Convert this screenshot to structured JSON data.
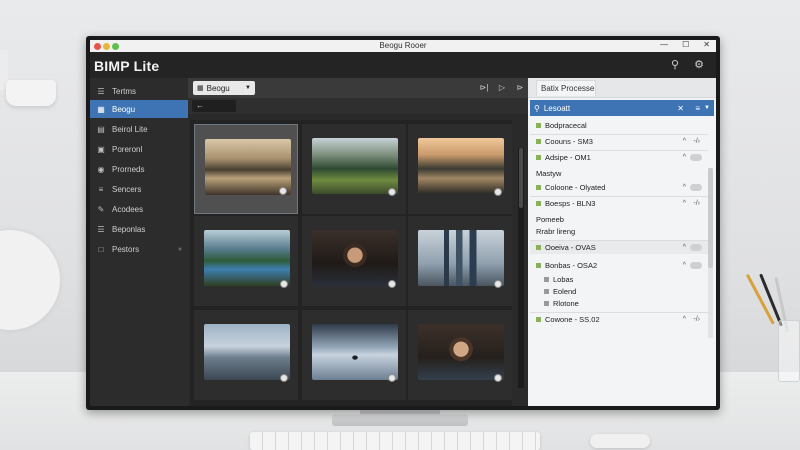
{
  "window": {
    "title": "Beogu Rooer",
    "controls": [
      "—",
      "☐",
      "✕"
    ]
  },
  "app": {
    "title": "BIMP Lite",
    "header_icons": [
      "search-icon",
      "settings-icon"
    ]
  },
  "sidebar": {
    "items": [
      {
        "label": "Tertms",
        "icon": "stack-icon",
        "active": false
      },
      {
        "label": "Beogu",
        "icon": "grid-icon",
        "active": true
      },
      {
        "label": "Beirol Lite",
        "icon": "layer-icon",
        "active": false
      },
      {
        "label": "Poreronl",
        "icon": "crop-icon",
        "active": false
      },
      {
        "label": "Prorneds",
        "icon": "filter-icon",
        "active": false
      },
      {
        "label": "Sencers",
        "icon": "sliders-icon",
        "active": false
      },
      {
        "label": "Acodees",
        "icon": "brush-icon",
        "active": false
      },
      {
        "label": "Beponlas",
        "icon": "list-icon",
        "active": false
      },
      {
        "label": "Pestors",
        "icon": "folder-icon",
        "active": false,
        "chevron": "«"
      }
    ]
  },
  "toolbar": {
    "dropdown_label": "Beogu",
    "buttons": [
      "⊳|",
      "▷",
      "⊳"
    ],
    "back_label": "←"
  },
  "thumbnails": [
    {
      "name": "lake-sunset",
      "style": "t-lake",
      "selected": true
    },
    {
      "name": "forest-river",
      "style": "t-forest",
      "selected": false
    },
    {
      "name": "sunset-lake",
      "style": "t-sunset",
      "selected": false
    },
    {
      "name": "mountain-river",
      "style": "t-river",
      "selected": false
    },
    {
      "name": "portrait-woman",
      "style": "t-woman1",
      "selected": false
    },
    {
      "name": "city-towers",
      "style": "t-city",
      "selected": false
    },
    {
      "name": "pier-sky",
      "style": "t-pier",
      "selected": false
    },
    {
      "name": "person-shore",
      "style": "t-walker",
      "selected": false
    },
    {
      "name": "portrait-woman-2",
      "style": "t-woman2",
      "selected": false
    }
  ],
  "right_panel": {
    "tab_label": "Batix Processe",
    "search_value": "Lesoatt",
    "search_clear": "✕",
    "rows": [
      {
        "label": "Bodpracecal",
        "kind": "plain"
      },
      {
        "label": "Coouns - SM3",
        "kind": "item",
        "a1": "^",
        "a2": "-/›"
      },
      {
        "label": "Adsipe - OM1",
        "kind": "item",
        "a1": "^",
        "a2": "toggle"
      },
      {
        "label": "Mastyw",
        "kind": "plain"
      },
      {
        "label": "Coloone - Olyated",
        "kind": "item",
        "a1": "^",
        "a2": "toggle"
      },
      {
        "label": "Boesps - BLN3",
        "kind": "item",
        "a1": "^",
        "a2": "-/›"
      },
      {
        "label": "Pomeeb",
        "kind": "plain"
      },
      {
        "label": "Rrabr lireng",
        "kind": "sub"
      },
      {
        "label": "Ooeiva - OVAS",
        "kind": "item",
        "a1": "^",
        "a2": "toggle"
      },
      {
        "label": "Bonbas - OSA2",
        "kind": "item",
        "a1": "^",
        "a2": "toggle"
      },
      {
        "label": "Lobas",
        "kind": "subsq"
      },
      {
        "label": "Eolend",
        "kind": "subsq"
      },
      {
        "label": "Rlotone",
        "kind": "subsq"
      },
      {
        "label": "Cowone - SS.02",
        "kind": "item",
        "a1": "^",
        "a2": "-/›"
      }
    ],
    "footer_icons": [
      "table-icon",
      "curve-icon",
      "export-icon",
      "node-icon"
    ]
  }
}
